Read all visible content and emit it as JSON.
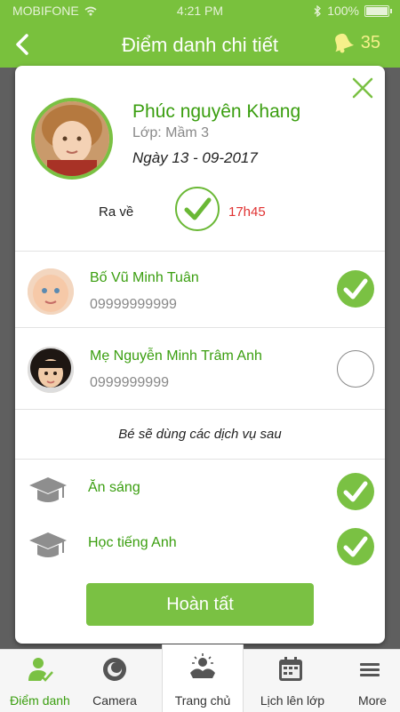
{
  "status_bar": {
    "carrier": "MOBIFONE",
    "time": "4:21 PM",
    "battery": "100%"
  },
  "header": {
    "title": "Điểm danh chi tiết",
    "notification_count": "35"
  },
  "student": {
    "name": "Phúc nguyên Khang",
    "class": "Lớp: Mầm 3",
    "date": "Ngày 13 - 09-2017",
    "checkout_label": "Ra về",
    "checkout_time": "17h45"
  },
  "pickups": [
    {
      "name": "Bố Vũ Minh Tuân",
      "phone": "09999999999",
      "checked": true
    },
    {
      "name": "Mẹ Nguyễn Minh Trâm Anh",
      "phone": "0999999999",
      "checked": false
    }
  ],
  "services_note": "Bé sẽ dùng các dịch vụ sau",
  "services": [
    {
      "label": "Ăn sáng",
      "checked": true
    },
    {
      "label": "Học tiếng Anh",
      "checked": true
    }
  ],
  "done_label": "Hoàn tất",
  "tabs": [
    {
      "label": "Điểm danh",
      "icon": "attendance-icon",
      "active": true
    },
    {
      "label": "Camera",
      "icon": "camera-icon",
      "active": false
    },
    {
      "label": "Trang chủ",
      "icon": "home-icon",
      "active": false
    },
    {
      "label": "Lịch lên lớp",
      "icon": "calendar-icon",
      "active": false
    },
    {
      "label": "More",
      "icon": "menu-icon",
      "active": false
    }
  ],
  "colors": {
    "accent": "#79c13d",
    "name_green": "#3a9e0f",
    "time_red": "#e03232"
  }
}
